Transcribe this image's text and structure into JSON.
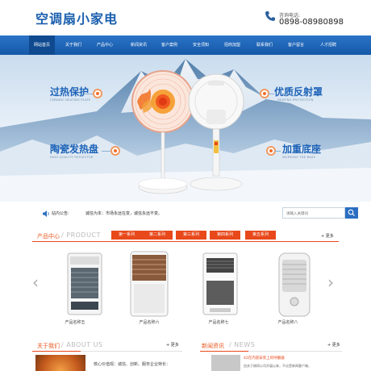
{
  "header": {
    "site_title": "空调扇小家电",
    "phone_label": "咨询电话:",
    "phone_number": "0898-08980898"
  },
  "nav": {
    "items": [
      "网站首页",
      "关于我们",
      "产品中心",
      "新闻资讯",
      "客户案例",
      "安全须知",
      "招商加盟",
      "联系我们",
      "客户留言",
      "人才招聘"
    ],
    "active_index": 0
  },
  "banner": {
    "features": [
      {
        "title": "过热保护",
        "sub": "CERAMIC HEATING PLATE"
      },
      {
        "title": "陶瓷发热盘",
        "sub": "HIGH-QUALITY REFLECTOR"
      },
      {
        "title": "优质反射罩",
        "sub": "HEATING PROTECTION"
      },
      {
        "title": "加重底座",
        "sub": "INCREASE THE BASE"
      }
    ]
  },
  "notice": {
    "label": "站内公告:",
    "text": "诚信为本：市场永远在变，诚信永远不变。",
    "search_placeholder": "请输入关键词"
  },
  "products": {
    "title_cn": "产品中心",
    "title_en": "/ PRODUCT",
    "series": [
      "第一系列",
      "第二系列",
      "第三系列",
      "第四系列",
      "第五系列"
    ],
    "more": "更多",
    "items": [
      {
        "name": "产品名称五"
      },
      {
        "name": "产品名称六"
      },
      {
        "name": "产品名称七"
      },
      {
        "name": "产品名称八"
      }
    ]
  },
  "about": {
    "title_cn": "关于我们",
    "title_en": "/ ABOUT US",
    "more": "更多",
    "text": "核心价值观：诚信、创新、服务企业特长："
  },
  "news": {
    "title_cn": "新闻资讯",
    "title_en": "/ NEWS",
    "more": "更多",
    "headline": "42在内容安装上的呼翻器",
    "desc": "由关于刚网公司开展以来，不论是新闻客户端，"
  },
  "colors": {
    "brand_blue": "#1d63b8",
    "nav_blue": "#2b74c7",
    "accent_orange": "#e8481a"
  }
}
